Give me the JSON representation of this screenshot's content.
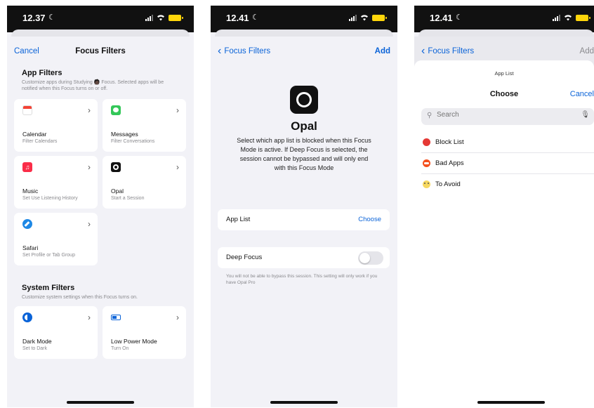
{
  "status": {
    "p1_time": "12.37",
    "p2_time": "12.41",
    "p3_time": "12.41"
  },
  "screen1": {
    "nav": {
      "cancel": "Cancel",
      "title": "Focus Filters"
    },
    "app_filters": {
      "title": "App Filters",
      "subtitle": "Customize apps during Studying 🧑🏿 Focus. Selected apps will be notified when this Focus turns on or off.",
      "tiles": [
        {
          "name": "Calendar",
          "sub": "Filter Calendars",
          "icon": "calendar-icon",
          "color": "#ffffff"
        },
        {
          "name": "Messages",
          "sub": "Filter Conversations",
          "icon": "messages-icon",
          "color": "#34c759"
        },
        {
          "name": "Music",
          "sub": "Set Use Listening History",
          "icon": "music-icon",
          "color": "#fa2d48"
        },
        {
          "name": "Opal",
          "sub": "Start a Session",
          "icon": "opal-icon",
          "color": "#111111"
        },
        {
          "name": "Safari",
          "sub": "Set Profile or Tab Group",
          "icon": "safari-icon",
          "color": "#1e88e5"
        }
      ]
    },
    "system_filters": {
      "title": "System Filters",
      "subtitle": "Customize system settings when this Focus turns on.",
      "tiles": [
        {
          "name": "Dark Mode",
          "sub": "Set to Dark",
          "icon": "dark-mode-icon",
          "color": "#0a63d8"
        },
        {
          "name": "Low Power Mode",
          "sub": "Turn On",
          "icon": "battery-icon",
          "color": "#0a63d8"
        }
      ]
    }
  },
  "screen2": {
    "nav": {
      "back": "Focus Filters",
      "add": "Add"
    },
    "app_name": "Opal",
    "description": "Select which app list is blocked when this Focus Mode is active. If Deep Focus is selected, the session cannot be bypassed and will only end with this Focus Mode",
    "app_list_label": "App List",
    "app_list_value": "Choose",
    "deep_focus_label": "Deep Focus",
    "deep_focus_on": false,
    "note": "You will not be able to bypass this session. This setting will only work if you have Opal Pro"
  },
  "screen3": {
    "nav": {
      "back": "Focus Filters",
      "add": "Add"
    },
    "sheet_label": "App List",
    "sheet_title": "Choose",
    "cancel": "Cancel",
    "search_placeholder": "Search",
    "items": [
      {
        "name": "Block List",
        "icon": "red-circle-icon",
        "color": "#e53935"
      },
      {
        "name": "Bad Apps",
        "icon": "red-mask-icon",
        "color": "#f4511e"
      },
      {
        "name": "To Avoid",
        "icon": "emoji-face-icon",
        "color": "#f6d860"
      }
    ]
  }
}
